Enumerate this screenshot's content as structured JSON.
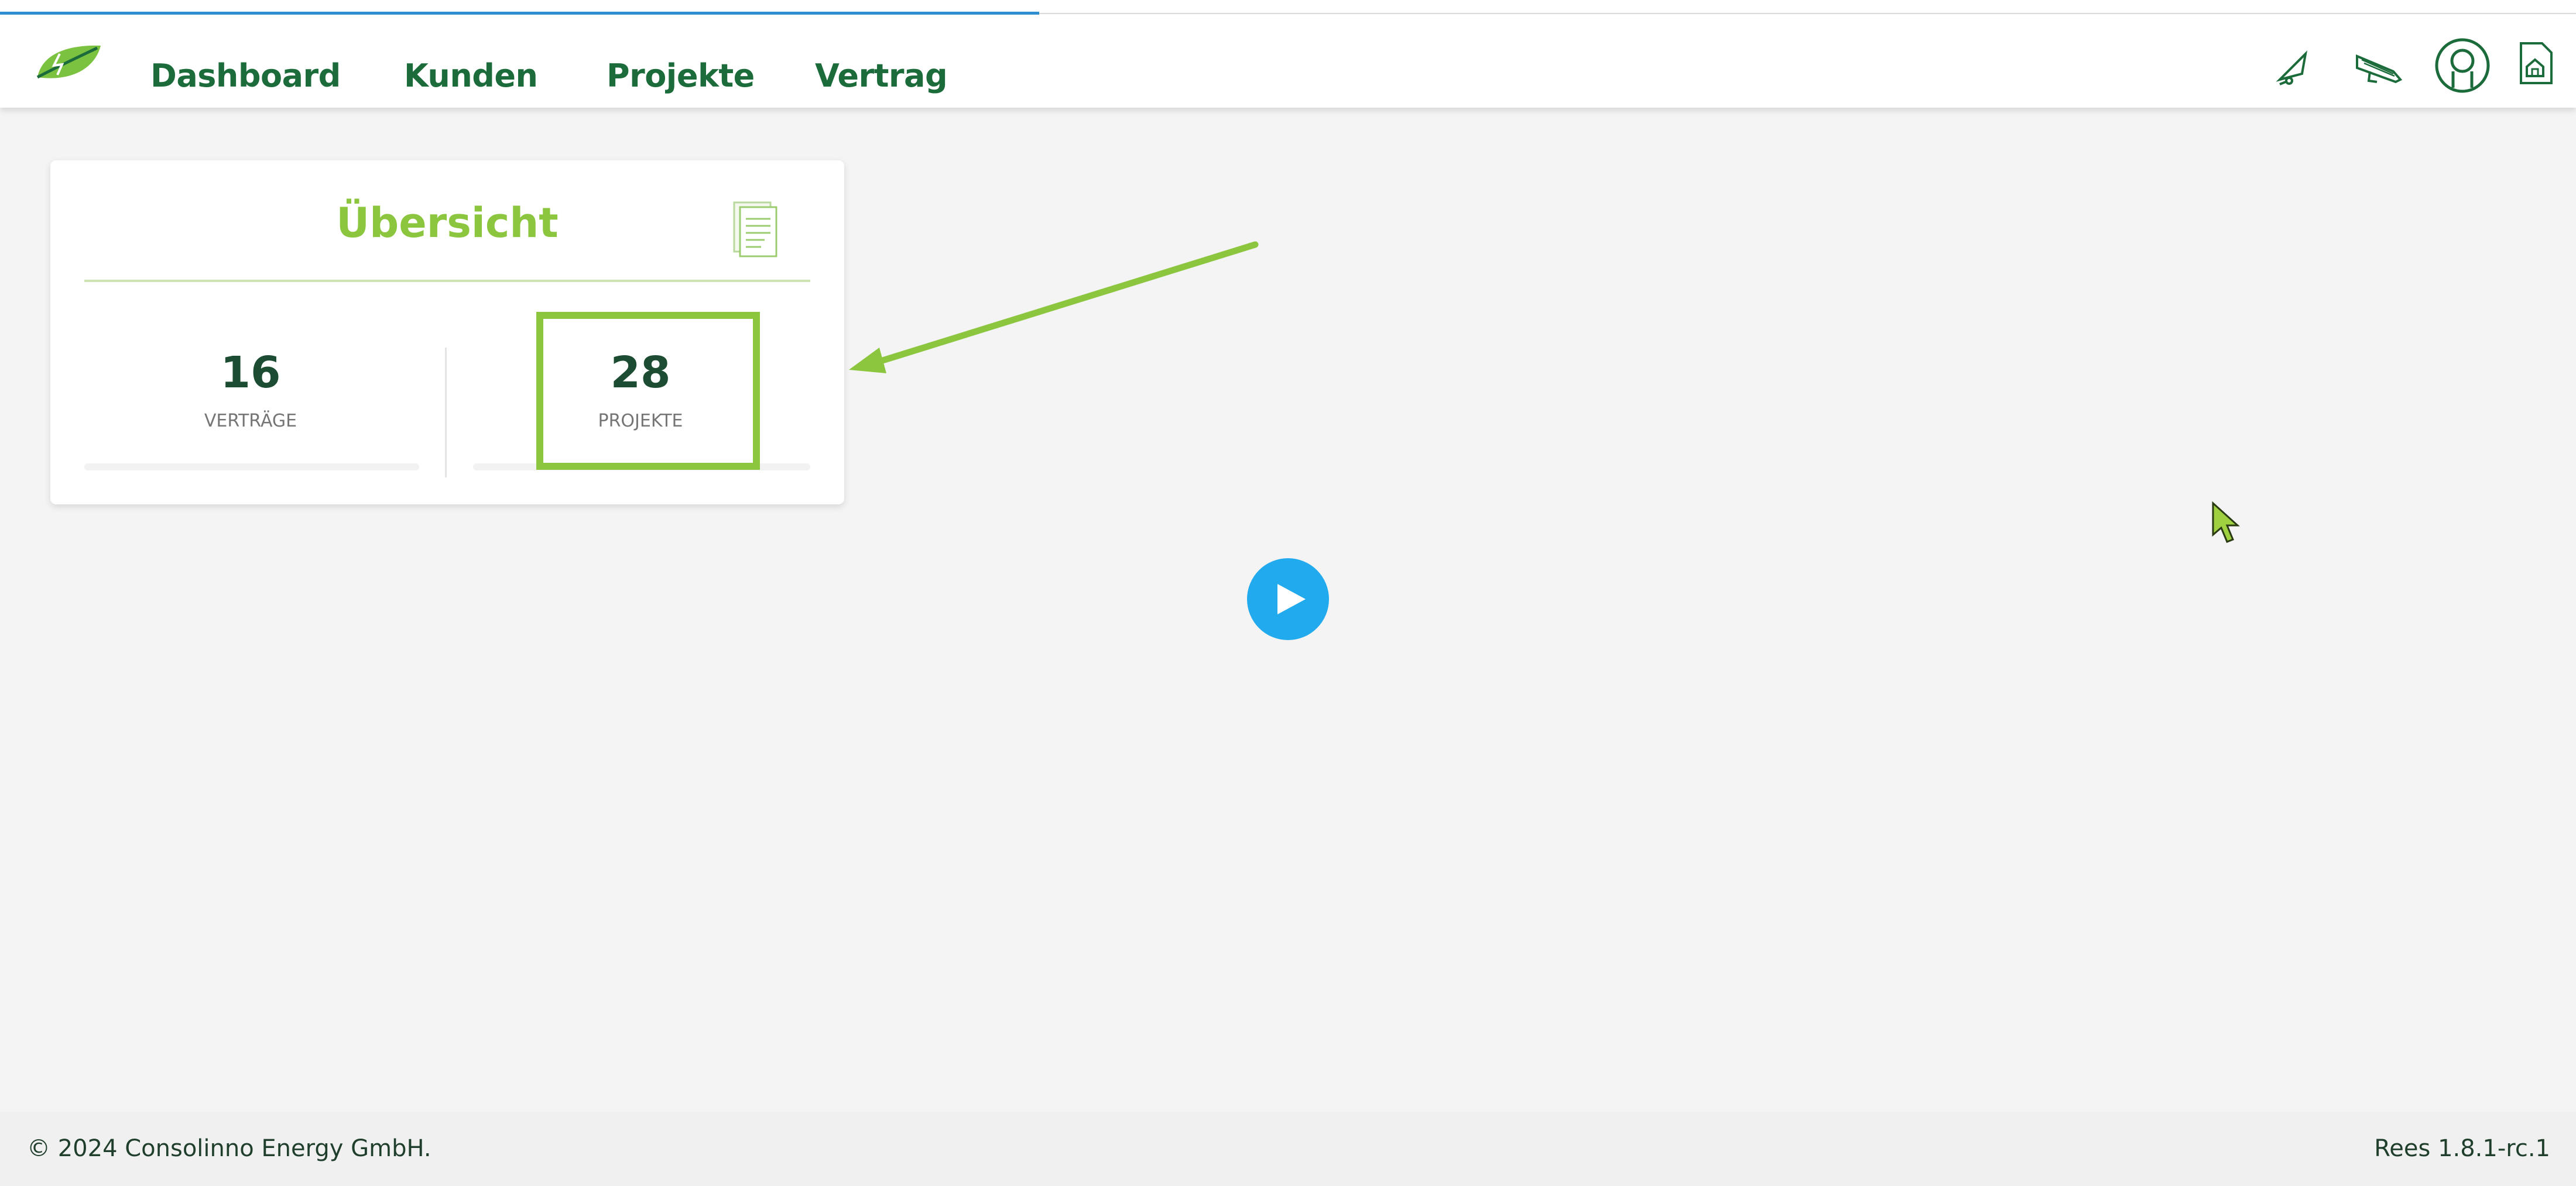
{
  "nav": {
    "items": [
      {
        "label": "Dashboard"
      },
      {
        "label": "Kunden"
      },
      {
        "label": "Projekte"
      },
      {
        "label": "Vertrag"
      }
    ],
    "icons": [
      "bell-icon",
      "megaphone-icon",
      "user-icon",
      "house-document-icon"
    ]
  },
  "card": {
    "title": "Übersicht",
    "stats": [
      {
        "value": "16",
        "label": "VERTRÄGE"
      },
      {
        "value": "28",
        "label": "PROJEKTE"
      }
    ]
  },
  "footer": {
    "copyright": "© 2024 Consolinno Energy GmbH.",
    "version": "Rees 1.8.1-rc.1"
  },
  "colors": {
    "brand_green": "#1c6b3b",
    "accent_green": "#8cc63f",
    "play_blue": "#22aaee",
    "background": "#f4f4f4"
  }
}
